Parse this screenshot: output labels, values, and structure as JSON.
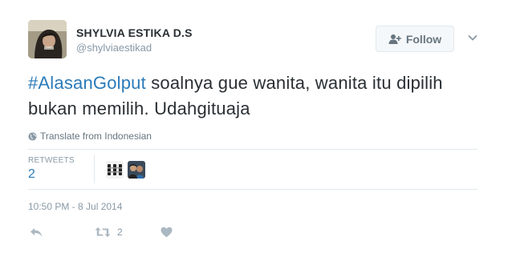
{
  "author": {
    "name": "SHYLVIA ESTIKA D.S",
    "handle": "@shylviaestikad"
  },
  "follow_button": {
    "label": "Follow"
  },
  "tweet": {
    "hashtag": "#AlasanGolput",
    "text_after_hashtag": " soalnya gue wanita, wanita itu dipilih bukan memilih. Udahgituaja"
  },
  "translate": {
    "label": "Translate from Indonesian"
  },
  "stats": {
    "retweets_label": "RETWEETS",
    "retweets_count": "2"
  },
  "timestamp": "10:50 PM - 8 Jul 2014",
  "actions": {
    "retweet_count": "2"
  },
  "colors": {
    "link": "#2b7bb9",
    "muted": "#8899a6",
    "text": "#292f33"
  },
  "icons": [
    "follow-person-plus-icon",
    "chevron-down-icon",
    "globe-icon",
    "reply-icon",
    "retweet-icon",
    "heart-icon"
  ]
}
